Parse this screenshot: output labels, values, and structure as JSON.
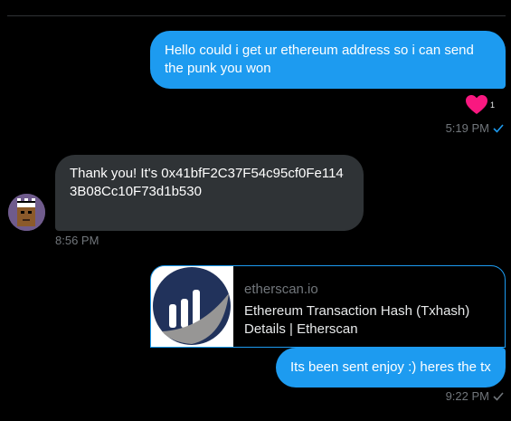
{
  "messages": [
    {
      "text": "Hello could i get ur ethereum address so i can send the punk you won",
      "time": "5:19 PM",
      "reaction_count": "1"
    },
    {
      "text": "Thank you! It's 0x41bfF2C37F54c95cf0Fe1143B08Cc10F73d1b530",
      "time": "8:56 PM"
    },
    {
      "text": "Its been sent enjoy :) heres the tx",
      "time": "9:22 PM"
    }
  ],
  "link_card": {
    "domain": "etherscan.io",
    "title": "Ethereum Transaction Hash (Txhash) Details | Etherscan"
  },
  "icons": {
    "reaction": "heart-icon",
    "status": "check-icon",
    "thumbnail": "etherscan-logo",
    "avatar": "cryptopunk-avatar"
  },
  "colors": {
    "accent": "#1d9bf0",
    "heart": "#f91880",
    "incoming_bubble": "#2f3336",
    "muted_text": "#71767b"
  }
}
